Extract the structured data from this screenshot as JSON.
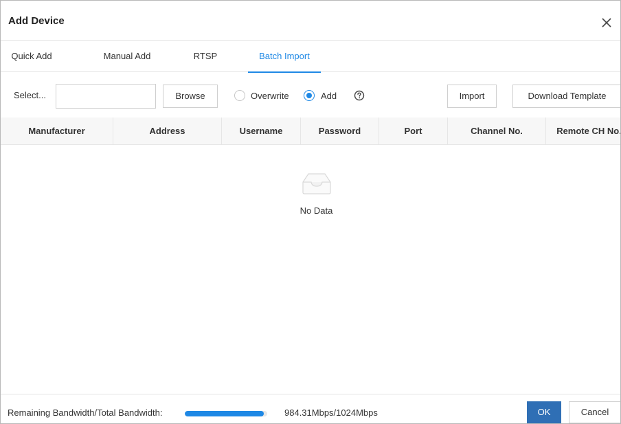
{
  "dialog": {
    "title": "Add Device",
    "close_icon": "close-icon"
  },
  "tabs": [
    {
      "label": "Quick Add",
      "active": false
    },
    {
      "label": "Manual Add",
      "active": false
    },
    {
      "label": "RTSP",
      "active": false
    },
    {
      "label": "Batch Import",
      "active": true
    }
  ],
  "toolbar": {
    "select_label": "Select...",
    "file_value": "",
    "browse_label": "Browse",
    "mode_options": [
      {
        "label": "Overwrite",
        "checked": false
      },
      {
        "label": "Add",
        "checked": true
      }
    ],
    "help_icon": "question-circle-icon",
    "import_label": "Import",
    "download_template_label": "Download Template"
  },
  "table": {
    "columns": [
      "Manufacturer",
      "Address",
      "Username",
      "Password",
      "Port",
      "Channel No.",
      "Remote CH No."
    ],
    "rows": [],
    "empty_icon": "inbox-icon",
    "empty_text": "No Data"
  },
  "footer": {
    "bandwidth_label": "Remaining Bandwidth/Total Bandwidth:",
    "bandwidth_fraction": 0.9612,
    "bandwidth_value": "984.31Mbps/1024Mbps",
    "ok_label": "OK",
    "cancel_label": "Cancel"
  },
  "colors": {
    "accent": "#1e88e5",
    "ok_button": "#2f6fb5"
  }
}
